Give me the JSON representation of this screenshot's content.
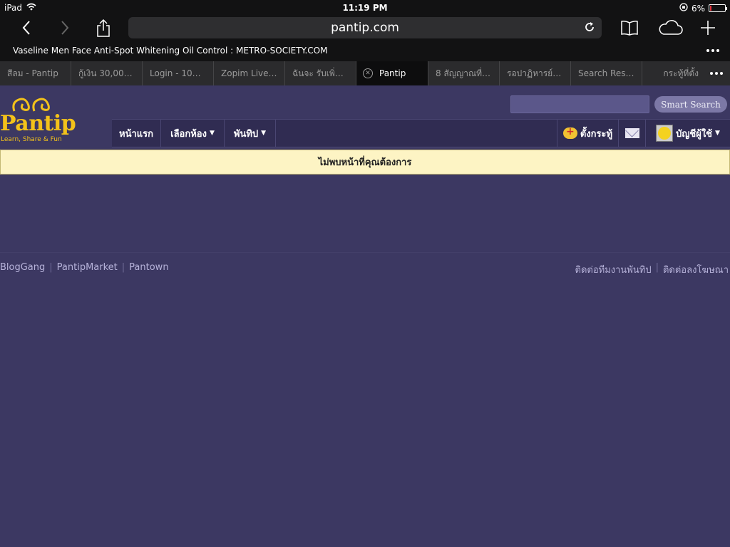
{
  "status_bar": {
    "device": "iPad",
    "time": "11:19 PM",
    "battery": "6%",
    "battery_level": 0.06,
    "wifi_icon": "wifi-icon",
    "lock_icon": "orientation-lock-icon"
  },
  "toolbar": {
    "url": "pantip.com",
    "icons": [
      "back-icon",
      "forward-icon",
      "share-icon",
      "reload-icon",
      "bookmarks-icon",
      "icloud-tabs-icon",
      "new-tab-icon"
    ]
  },
  "page_title": "Vaseline Men Face Anti-Spot Whitening Oil Control : METRO-SOCIETY.COM",
  "tabs": [
    "สีลม - Pantip",
    "กู้เงิน 30,000…",
    "Login - 100…",
    "Zopim Live…",
    "ฉันจะ รับเพิ่มไ…",
    "Pantip",
    "8 สัญญาณที่…",
    "รอปาฏิหารย์…",
    "Search Res…",
    "กระทู้ที่ตั้ง"
  ],
  "site": {
    "logo_text": "Pantip",
    "logo_tagline": "Learn, Share & Fun",
    "search_placeholder": "",
    "search_button": "Smart Search",
    "nav": {
      "home": "หน้าแรก",
      "rooms": "เลือกห้อง",
      "pantip": "พันทิป",
      "new_topic": "ตั้งกระทู้",
      "account": "บัญชีผู้ใช้",
      "caret": "▼"
    },
    "alert_message": "ไม่พบหน้าที่คุณต้องการ",
    "footer_left": [
      "BlogGang",
      "PantipMarket",
      "Pantown"
    ],
    "footer_right": [
      "ติดต่อทีมงานพันทิป",
      "ติดต่อลงโฆษณา"
    ],
    "footer_separator": "|"
  },
  "colors": {
    "site_background": "#3c3862",
    "brand_yellow": "#f3c21a",
    "alert_background": "#fdf4c4",
    "browser_chrome": "#121213",
    "battery_low": "#e0303a"
  }
}
